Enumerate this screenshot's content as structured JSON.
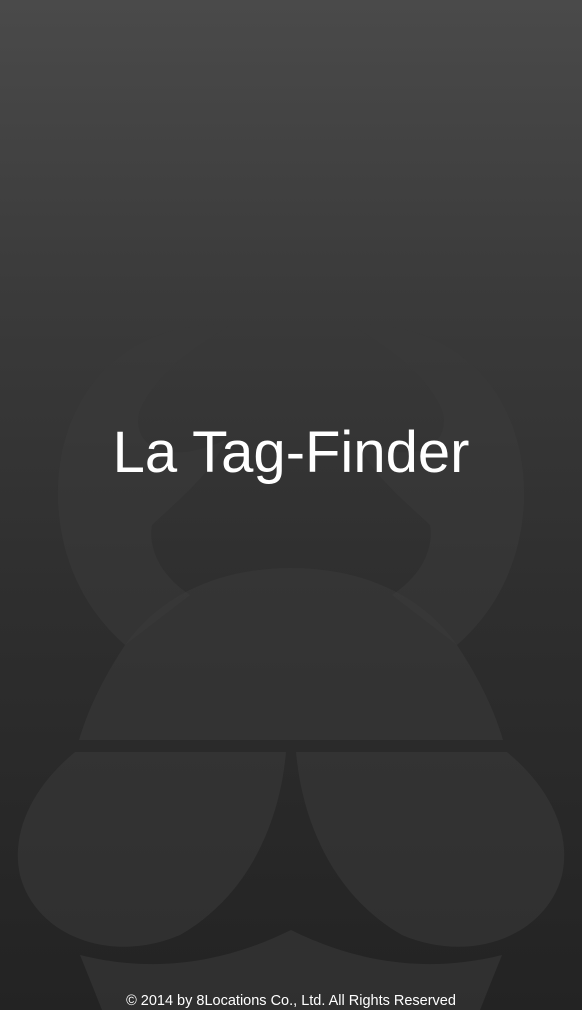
{
  "splash": {
    "title": "La Tag-Finder",
    "copyright": "© 2014 by 8Locations Co., Ltd. All Rights Reserved",
    "logo": "8locations-logo-watermark"
  },
  "colors": {
    "background_top": "#4a4a4a",
    "background_bottom": "#232323",
    "logo_watermark": "#383838",
    "text": "#ffffff"
  }
}
